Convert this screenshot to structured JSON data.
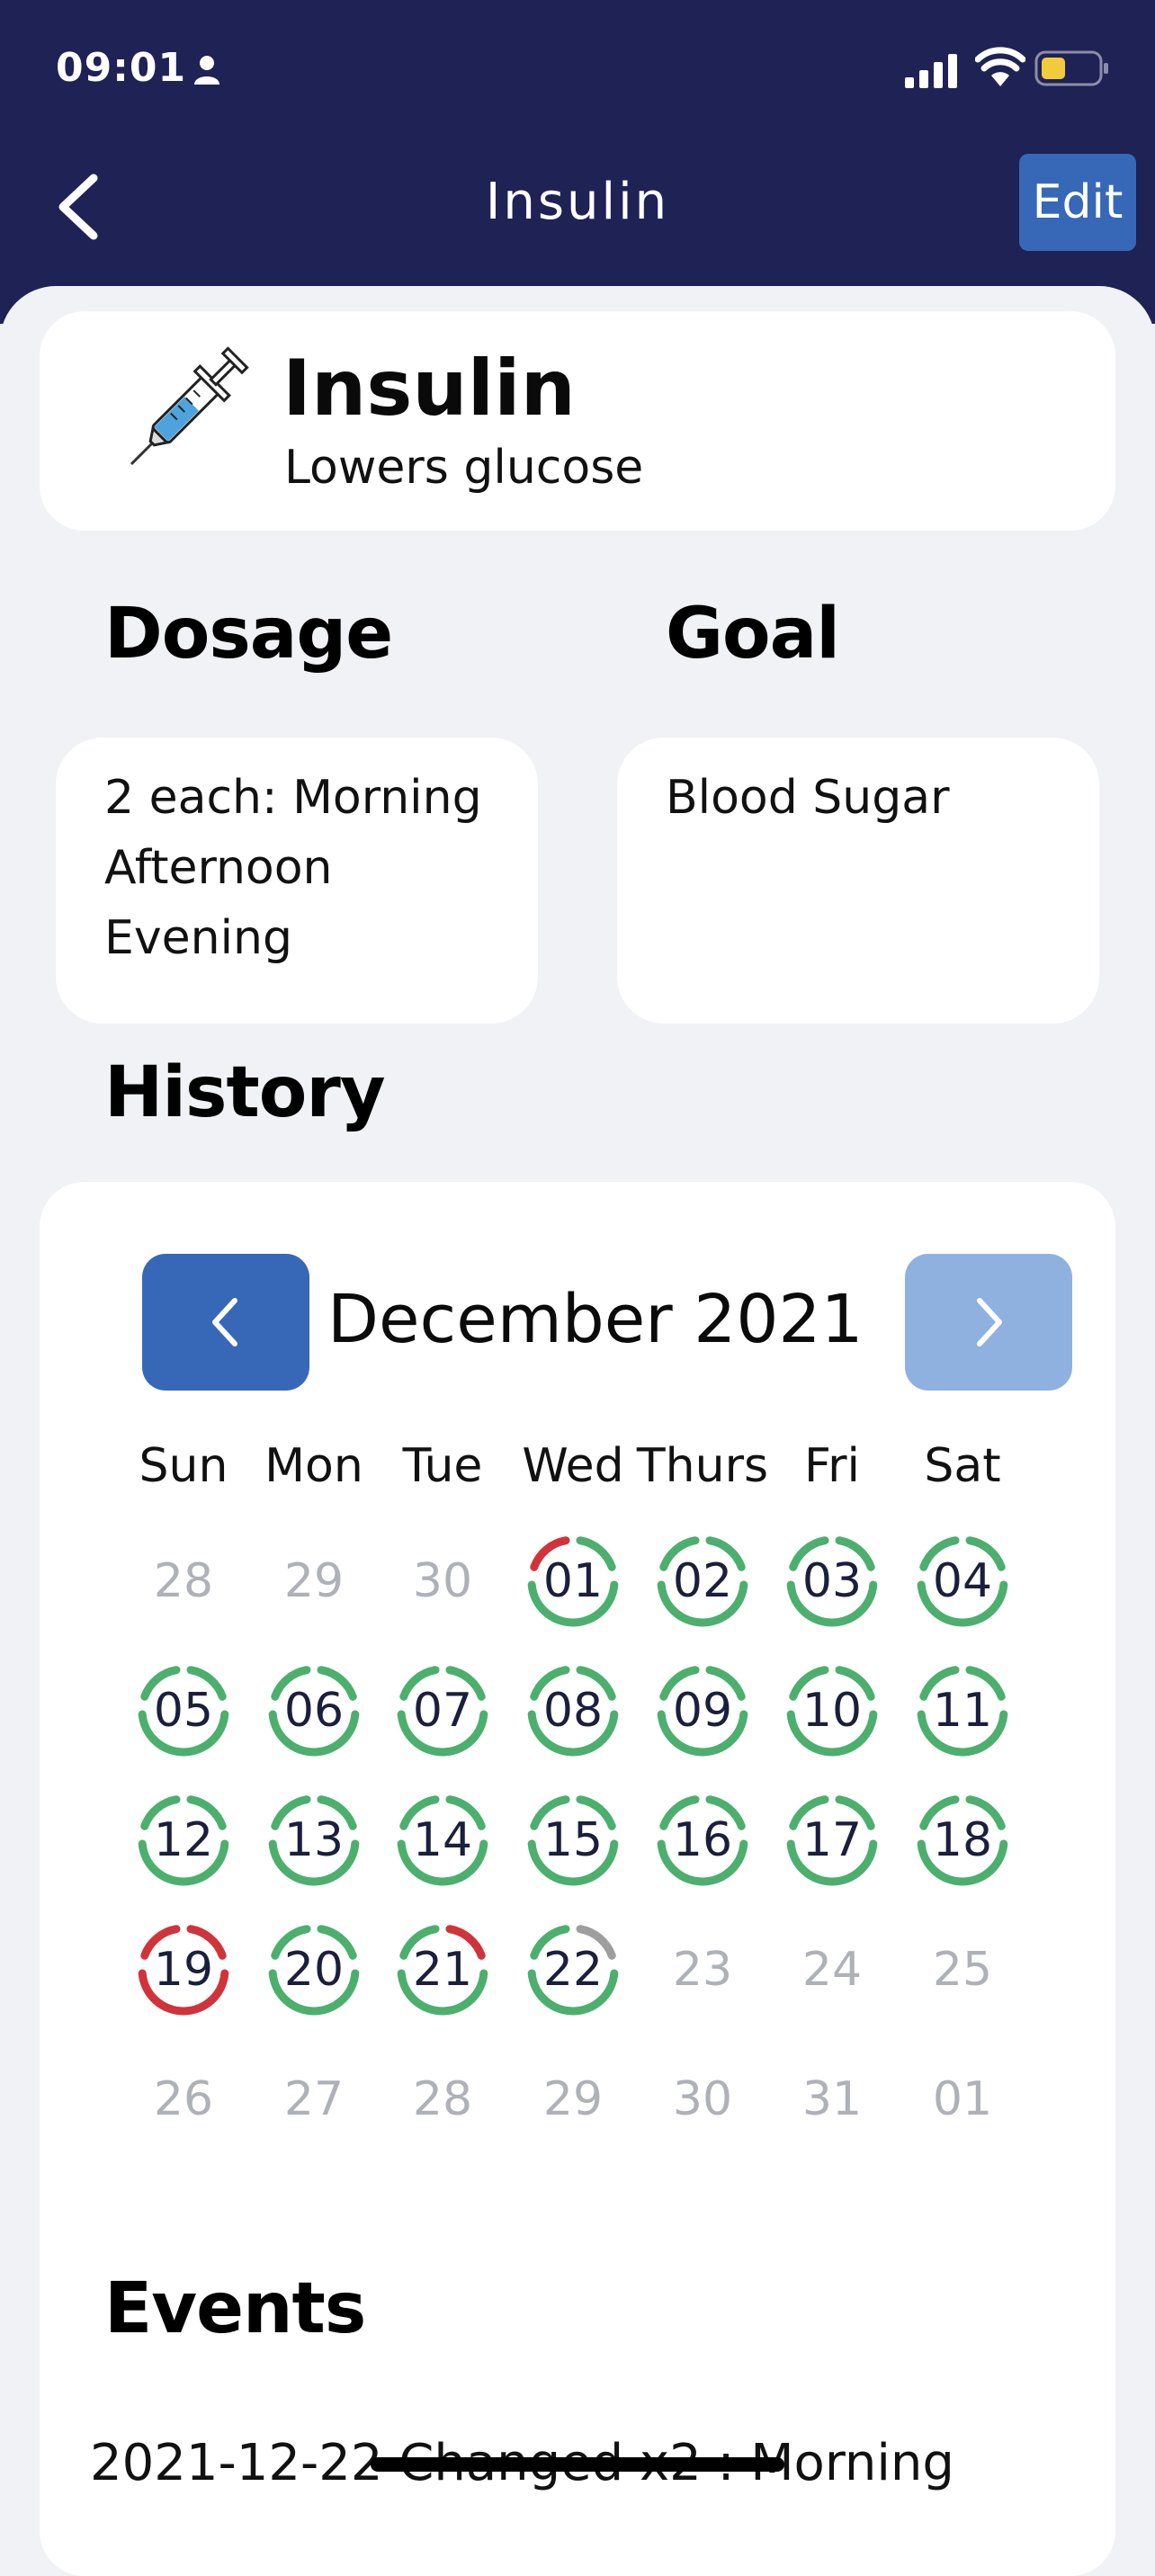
{
  "status_bar": {
    "time": "09:01"
  },
  "header": {
    "title": "Insulin",
    "edit_label": "Edit"
  },
  "medication": {
    "name": "Insulin",
    "description": "Lowers glucose"
  },
  "dosage": {
    "heading": "Dosage",
    "text": "2 each: Morning\nAfternoon\nEvening"
  },
  "goal": {
    "heading": "Goal",
    "text": "Blood Sugar"
  },
  "history": {
    "heading": "History",
    "month": "December 2021",
    "weekdays": [
      "Sun",
      "Mon",
      "Tue",
      "Wed",
      "Thurs",
      "Fri",
      "Sat"
    ],
    "status_colors": {
      "taken": "#4CAF6E",
      "missed": "#D0343A",
      "pending": "#9E9E9E"
    },
    "weeks": [
      [
        {
          "d": "28",
          "out": true
        },
        {
          "d": "29",
          "out": true
        },
        {
          "d": "30",
          "out": true
        },
        {
          "d": "01",
          "s": [
            "missed",
            "taken",
            "taken"
          ]
        },
        {
          "d": "02",
          "s": [
            "taken",
            "taken",
            "taken"
          ]
        },
        {
          "d": "03",
          "s": [
            "taken",
            "taken",
            "taken"
          ]
        },
        {
          "d": "04",
          "s": [
            "taken",
            "taken",
            "taken"
          ]
        }
      ],
      [
        {
          "d": "05",
          "s": [
            "taken",
            "taken",
            "taken"
          ]
        },
        {
          "d": "06",
          "s": [
            "taken",
            "taken",
            "taken"
          ]
        },
        {
          "d": "07",
          "s": [
            "taken",
            "taken",
            "taken"
          ]
        },
        {
          "d": "08",
          "s": [
            "taken",
            "taken",
            "taken"
          ]
        },
        {
          "d": "09",
          "s": [
            "taken",
            "taken",
            "taken"
          ]
        },
        {
          "d": "10",
          "s": [
            "taken",
            "taken",
            "taken"
          ]
        },
        {
          "d": "11",
          "s": [
            "taken",
            "taken",
            "taken"
          ]
        }
      ],
      [
        {
          "d": "12",
          "s": [
            "taken",
            "taken",
            "taken"
          ]
        },
        {
          "d": "13",
          "s": [
            "taken",
            "taken",
            "taken"
          ]
        },
        {
          "d": "14",
          "s": [
            "taken",
            "taken",
            "taken"
          ]
        },
        {
          "d": "15",
          "s": [
            "taken",
            "taken",
            "taken"
          ]
        },
        {
          "d": "16",
          "s": [
            "taken",
            "taken",
            "taken"
          ]
        },
        {
          "d": "17",
          "s": [
            "taken",
            "taken",
            "taken"
          ]
        },
        {
          "d": "18",
          "s": [
            "taken",
            "taken",
            "taken"
          ]
        }
      ],
      [
        {
          "d": "19",
          "s": [
            "missed",
            "missed",
            "missed"
          ]
        },
        {
          "d": "20",
          "s": [
            "taken",
            "taken",
            "taken"
          ]
        },
        {
          "d": "21",
          "s": [
            "taken",
            "missed",
            "taken"
          ]
        },
        {
          "d": "22",
          "s": [
            "taken",
            "pending",
            "taken"
          ]
        },
        {
          "d": "23",
          "out": true
        },
        {
          "d": "24",
          "out": true
        },
        {
          "d": "25",
          "out": true
        }
      ],
      [
        {
          "d": "26",
          "out": true
        },
        {
          "d": "27",
          "out": true
        },
        {
          "d": "28",
          "out": true
        },
        {
          "d": "29",
          "out": true
        },
        {
          "d": "30",
          "out": true
        },
        {
          "d": "31",
          "out": true
        },
        {
          "d": "01",
          "out": true
        }
      ]
    ]
  },
  "events": {
    "heading": "Events",
    "items": [
      {
        "text": "2021-12-22 Changed x2 : Morning"
      }
    ]
  }
}
